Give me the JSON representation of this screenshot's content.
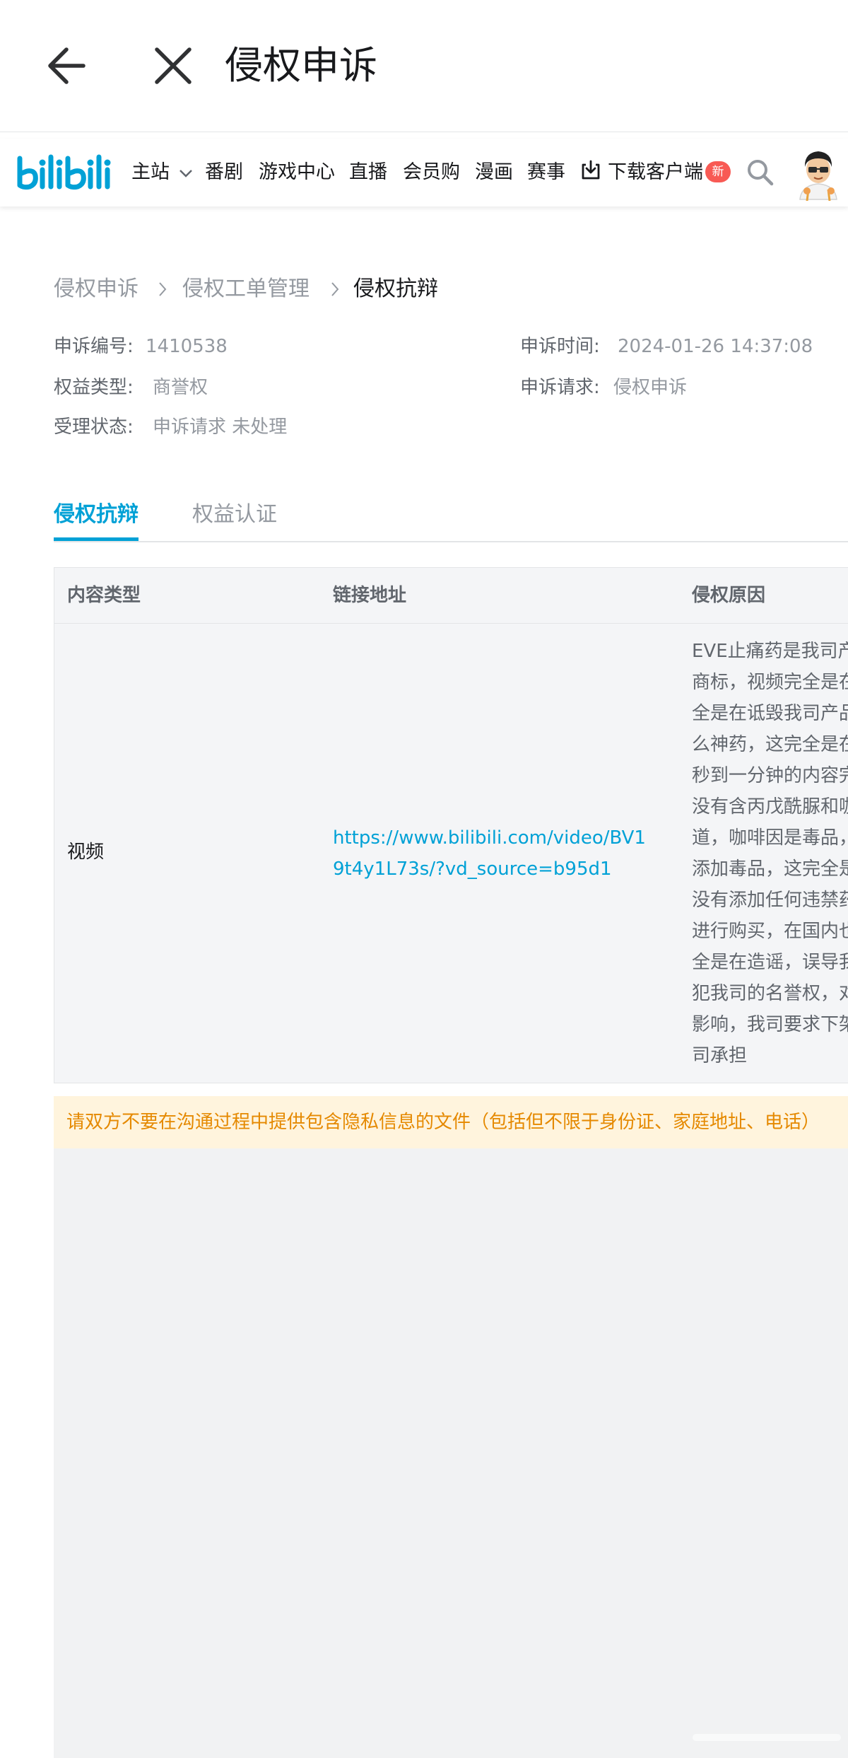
{
  "app_bar": {
    "title": "侵权申诉",
    "back_icon": "arrow-left-icon",
    "close_icon": "close-x-icon"
  },
  "bili_header": {
    "logo_text": "bilibili",
    "nav": {
      "main_station": "主站",
      "bangumi": "番剧",
      "game_center": "游戏中心",
      "live": "直播",
      "membership_shop": "会员购",
      "manga": "漫画",
      "esports": "赛事",
      "download_client": "下载客户端"
    },
    "new_badge": "新",
    "brand_color": "#00a1d6",
    "badge_color": "#f85a54"
  },
  "breadcrumb": {
    "items": [
      "侵权申诉",
      "侵权工单管理",
      "侵权抗辩"
    ]
  },
  "complaint_info": {
    "complaint_no_label": "申诉编号:",
    "complaint_no_value": "1410538",
    "complaint_time_label": "申诉时间:",
    "complaint_time_value": "2024-01-26 14:37:08",
    "rights_type_label": "权益类型:",
    "rights_type_value": "商誉权",
    "request_label": "申诉请求:",
    "request_value": "侵权申诉",
    "status_label": "受理状态:",
    "status_value": "申诉请求 未处理"
  },
  "tabs": {
    "active": "侵权抗辩",
    "inactive": "权益认证"
  },
  "table": {
    "headers": {
      "content_type": "内容类型",
      "link_address": "链接地址",
      "reason": "侵权原因"
    },
    "row": {
      "content_type": "视频",
      "link": "https://www.bilibili.com/video/BV19t4y1L73s/?vd_source=b95d1",
      "reason_lines": [
        "EVE止痛药是我司产",
        "商标，视频完全是在",
        "全是在诋毁我司产品",
        "么神药，这完全是在",
        "秒到一分钟的内容完",
        "没有含丙戊酰脲和咖",
        "道，咖啡因是毒品，",
        "添加毒品，这完全是",
        "没有添加任何违禁药",
        "进行购买，在国内也",
        "全是在造谣，误导我",
        "犯我司的名誉权，对",
        "影响，我司要求下架",
        "司承担"
      ]
    }
  },
  "notice": {
    "text": "请双方不要在沟通过程中提供包含隐私信息的文件（包括但不限于身份证、家庭地址、电话）"
  }
}
